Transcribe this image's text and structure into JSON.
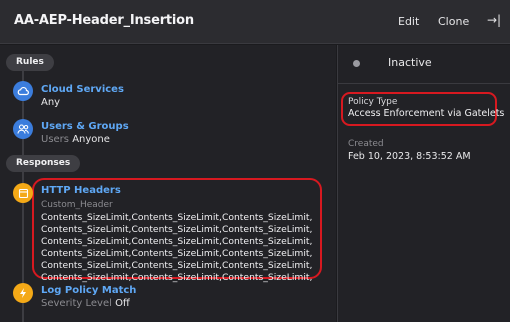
{
  "header": {
    "title": "AA-AEP-Header_Insertion",
    "edit_label": "Edit",
    "clone_label": "Clone",
    "collapse_icon": "→|"
  },
  "left": {
    "rules_label": "Rules",
    "responses_label": "Responses",
    "cloud_services": {
      "title": "Cloud Services",
      "value": "Any"
    },
    "users_groups": {
      "title": "Users & Groups",
      "prefix": "Users",
      "value": "Anyone"
    },
    "http_headers": {
      "title": "HTTP Headers",
      "subtitle": "Custom_Header",
      "contents": "Contents_SizeLimit,Contents_SizeLimit,Contents_SizeLimit,Contents_SizeLimit,Contents_SizeLimit,Contents_SizeLimit,Contents_SizeLimit,Contents_SizeLimit,Contents_SizeLimit,Contents_SizeLimit,Contents_SizeLimit,Contents_SizeLimit,Contents_SizeLimit,Contents_SizeLimit,Contents_SizeLimit,Contents_SizeLimit,Contents_SizeLimit,Contents_SizeLimit,"
    },
    "log_policy": {
      "title": "Log Policy Match",
      "prefix": "Severity Level",
      "value": "Off"
    }
  },
  "right": {
    "status": "Inactive",
    "policy_type_label": "Policy Type",
    "policy_type_value": "Access Enforcement via Gatelets",
    "created_label": "Created",
    "created_value": "Feb 10, 2023, 8:53:52 AM"
  },
  "colors": {
    "accent_blue": "#3b7ddd",
    "link_blue": "#5fa8f5",
    "highlight_red": "#d71920",
    "response_yellow": "#f4a917"
  }
}
